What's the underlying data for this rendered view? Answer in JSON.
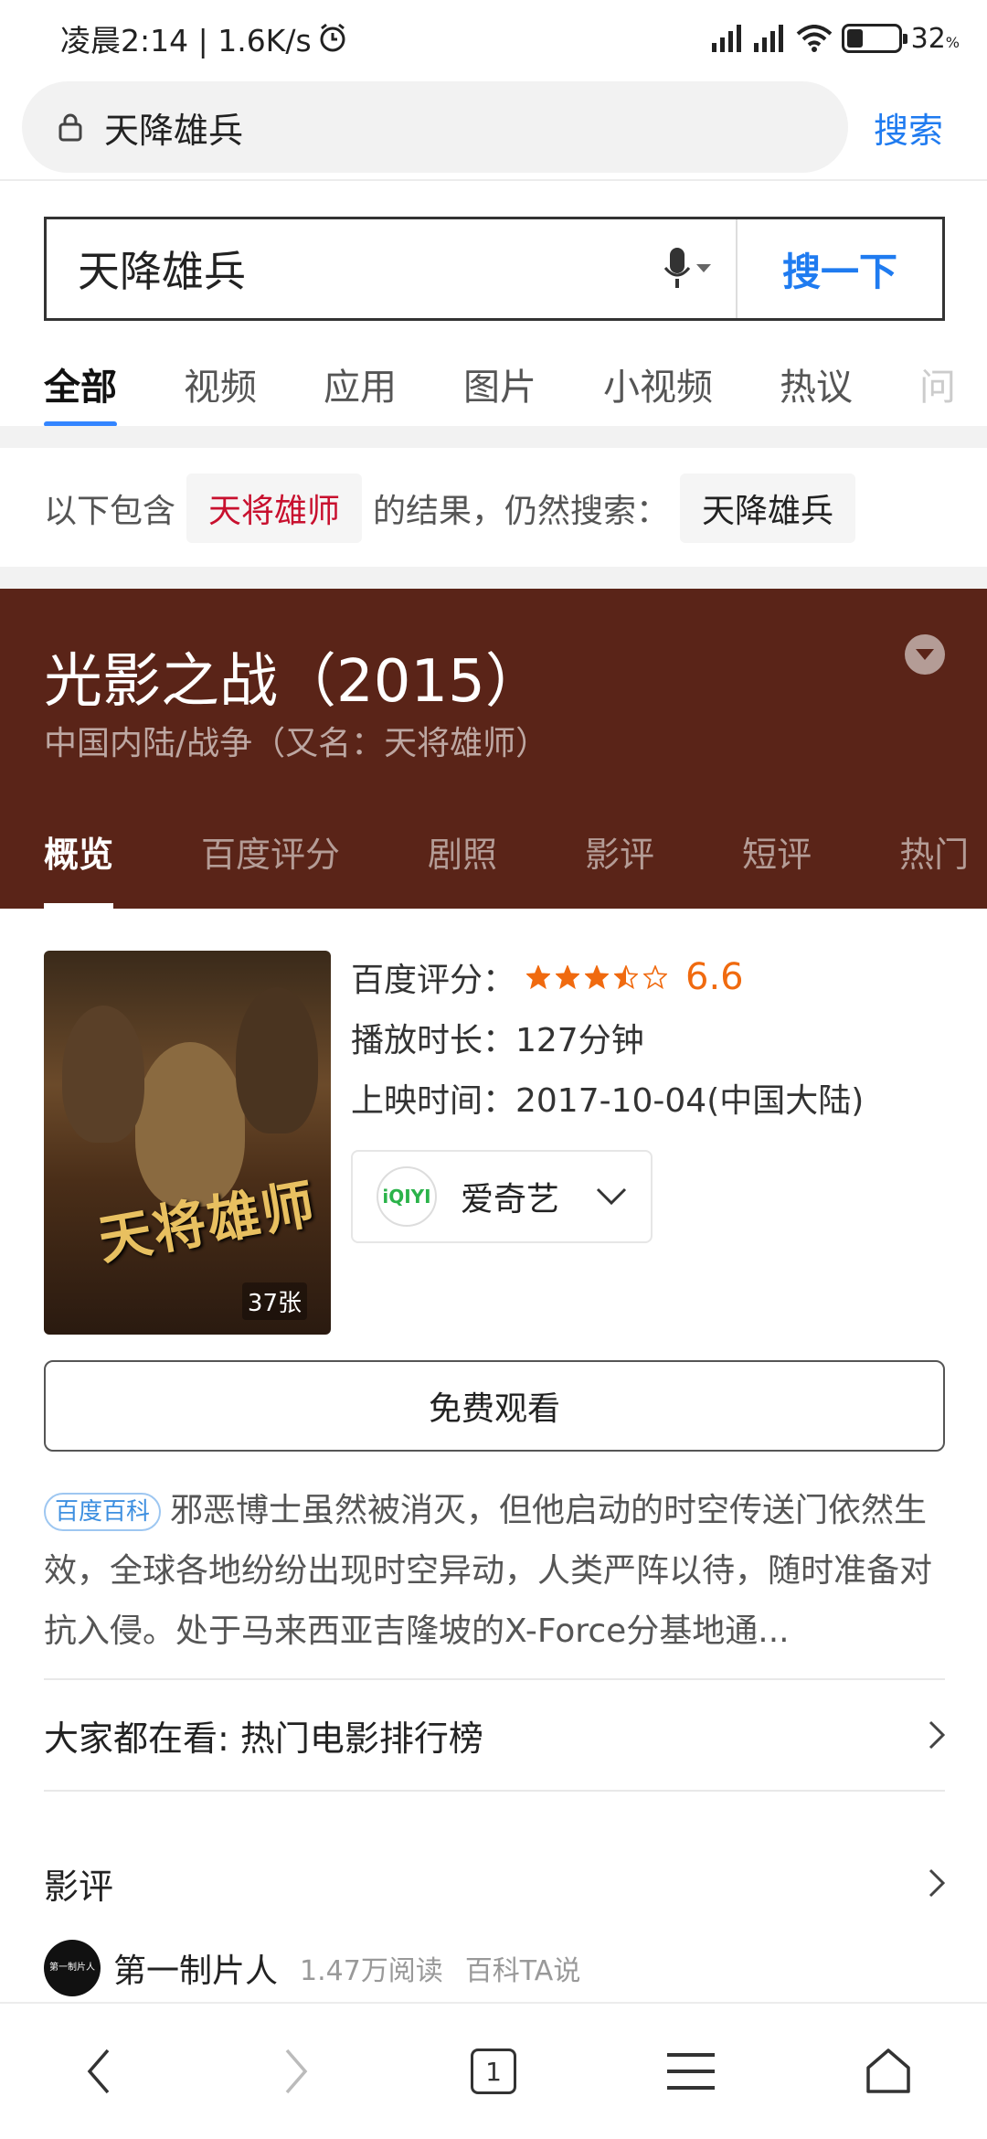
{
  "status_bar": {
    "time_speed": "凌晨2:14 | 1.6K/s",
    "battery_pct": "32",
    "battery_unit": "%",
    "battery_level": 0.32
  },
  "browser": {
    "url_text": "天降雄兵",
    "search_label": "搜索"
  },
  "search": {
    "query": "天降雄兵",
    "button_label": "搜一下"
  },
  "tabs": [
    {
      "label": "全部",
      "active": true
    },
    {
      "label": "视频"
    },
    {
      "label": "应用"
    },
    {
      "label": "图片"
    },
    {
      "label": "小视频"
    },
    {
      "label": "热议"
    },
    {
      "label": "问"
    }
  ],
  "correction": {
    "prefix": "以下包含",
    "corrected": "天将雄师",
    "middle": "的结果，仍然搜索：",
    "original": "天降雄兵"
  },
  "movie": {
    "title": "光影之战（2015）",
    "subtitle": "中国内陆/战争（又名：天将雄师）",
    "tabs": [
      {
        "label": "概览",
        "active": true
      },
      {
        "label": "百度评分"
      },
      {
        "label": "剧照"
      },
      {
        "label": "影评"
      },
      {
        "label": "短评"
      },
      {
        "label": "热门"
      }
    ],
    "poster_text": "天将雄师",
    "poster_count": "37张",
    "rating_label": "百度评分：",
    "rating_value": "6.6",
    "rating_stars": 3.5,
    "duration": "播放时长：127分钟",
    "release": "上映时间：2017-10-04(中国大陆)",
    "platform_logo": "iQIYI",
    "platform_name": "爱奇艺",
    "watch_label": "免费观看",
    "baike_tag": "百度百科",
    "abstract": "邪恶博士虽然被消灭，但他启动的时空传送门依然生效，全球各地纷纷出现时空异动，人类严阵以待，随时准备对抗入侵。处于马来西亚吉隆坡的X-Force分基地通..."
  },
  "popular": {
    "label": "大家都在看: 热门电影排行榜"
  },
  "reviews": {
    "label": "影评",
    "author": "第一制片人",
    "avatar_text": "第一制片人",
    "reads": "1.47万阅读",
    "source": "百科TA说"
  },
  "bottom_nav": {
    "tab_count": "1"
  },
  "colors": {
    "accent": "#1f7bf0",
    "header_bg": "#5a2418",
    "rating": "#f06a0f",
    "correction_red": "#c8102e"
  }
}
